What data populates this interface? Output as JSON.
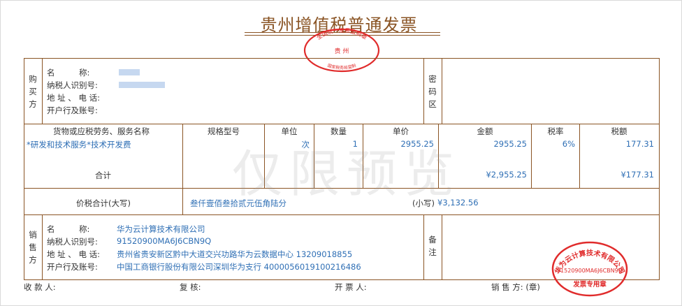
{
  "title": "贵州增值税普通发票",
  "buyer": {
    "section_label": "购买方",
    "name_label": "名　　　称:",
    "tax_id_label": "纳税人识别号:",
    "address_label": "地 址 、 电 话:",
    "bank_label": "开户行及账号:"
  },
  "password_area_label": "密码区",
  "items": {
    "headers": [
      "货物或应税劳务、服务名称",
      "规格型号",
      "单位",
      "数量",
      "单价",
      "金额",
      "税率",
      "税额"
    ],
    "rows": [
      {
        "name": "*研发和技术服务*技术开发费",
        "spec": "",
        "unit": "次",
        "qty": "1",
        "price": "2955.25",
        "amount": "2955.25",
        "rate": "6%",
        "tax": "177.31"
      }
    ],
    "total_label": "合计",
    "total_amount": "¥2,955.25",
    "total_tax": "¥177.31"
  },
  "total": {
    "label": "价税合计(大写)",
    "in_words": "叁仟壹佰叁拾贰元伍角陆分",
    "small_label": "(小写)",
    "in_figures": "¥3,132.56"
  },
  "seller": {
    "section_label": "销售方",
    "name_label": "名　　　称:",
    "name": "华为云计算技术有限公司",
    "tax_id_label": "纳税人识别号:",
    "tax_id": "91520900MA6J6CBN9Q",
    "address_label": "地 址 、 电 话:",
    "address": "贵州省贵安新区黔中大道交兴功路华为云数据中心 13209018855",
    "bank_label": "开户行及账号:",
    "bank": "中国工商银行股份有限公司深圳华为支行 4000056019100216486"
  },
  "remarks_label": "备注",
  "footer": {
    "payee": "收 款 人:",
    "reviewer": "复 核:",
    "issuer": "开 票 人:",
    "seller_seal": "销 售 方: (章)"
  },
  "watermark": "仅限预览",
  "stamps": {
    "official_top": "全国统一发票监制章",
    "official_city": "贵 州",
    "official_bottom": "国家税务局监制",
    "seller_name": "华为云计算技术有限公司",
    "seller_tax_id": "91520900MA6J6CBN9Q",
    "seller_type": "发票专用章",
    "color": "#e02b2b"
  },
  "colors": {
    "border": "#8a5424",
    "value_text": "#2f6fb5"
  }
}
